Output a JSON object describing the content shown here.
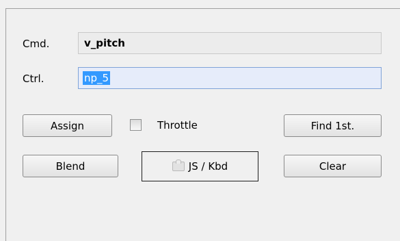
{
  "cmd": {
    "label": "Cmd.",
    "value": "v_pitch"
  },
  "ctrl": {
    "label": "Ctrl.",
    "value": "np_5"
  },
  "buttons": {
    "assign": "Assign",
    "find_first": "Find 1st.",
    "blend": "Blend",
    "clear": "Clear",
    "js_kbd": "JS / Kbd"
  },
  "throttle": {
    "label": "Throttle",
    "checked": false
  }
}
